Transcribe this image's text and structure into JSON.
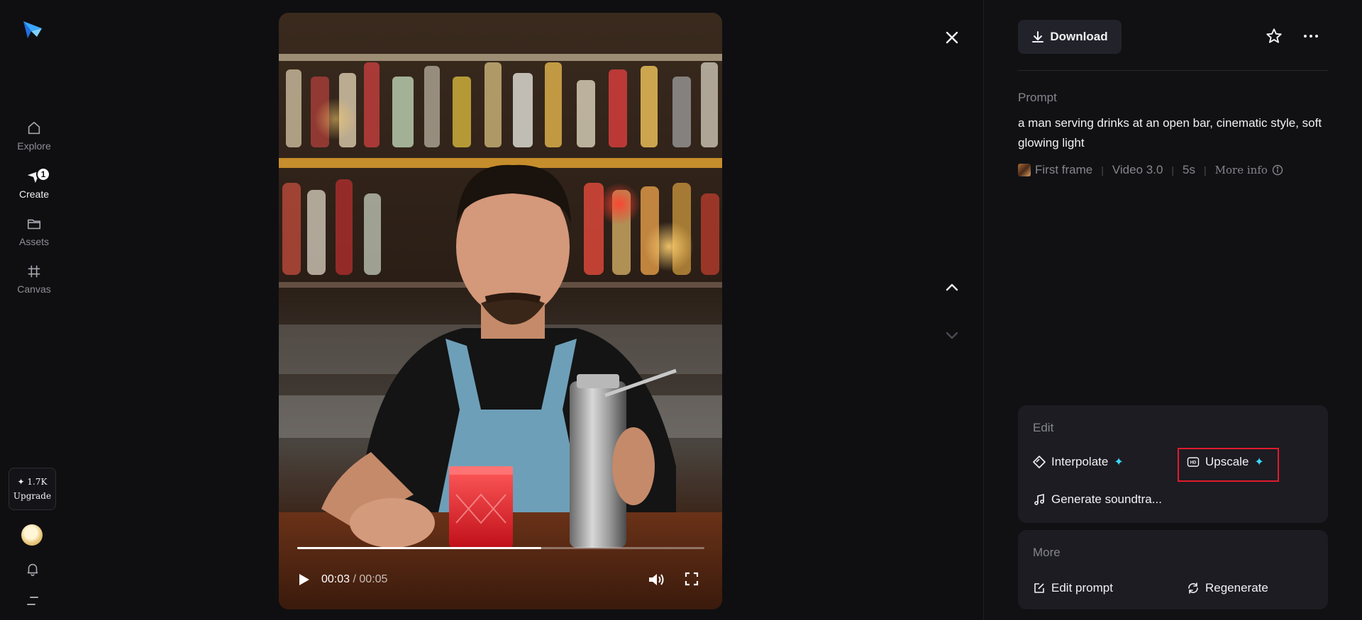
{
  "sidebar": {
    "items": [
      {
        "label": "Explore",
        "icon": "home-icon"
      },
      {
        "label": "Create",
        "icon": "create-icon",
        "badge": "1"
      },
      {
        "label": "Assets",
        "icon": "folder-icon"
      },
      {
        "label": "Canvas",
        "icon": "frame-icon"
      }
    ],
    "upgrade": {
      "credits": "✦ 1.7K",
      "label": "Upgrade"
    }
  },
  "video": {
    "current_time": "00:03",
    "duration": "/ 00:05",
    "progress": 0.6
  },
  "panel": {
    "download_label": "Download",
    "prompt_label": "Prompt",
    "prompt_text": "a man serving drinks at an open bar, cinematic style, soft glowing light",
    "meta": {
      "first_frame": "First frame",
      "model": "Video 3.0",
      "length": "5s",
      "more_info": "More info"
    },
    "edit": {
      "title": "Edit",
      "interpolate": "Interpolate",
      "upscale": "Upscale",
      "soundtrack": "Generate soundtra..."
    },
    "more": {
      "title": "More",
      "edit_prompt": "Edit prompt",
      "regenerate": "Regenerate"
    },
    "accent_color": "#3fd8ff",
    "highlight_color": "#e01b2e"
  }
}
